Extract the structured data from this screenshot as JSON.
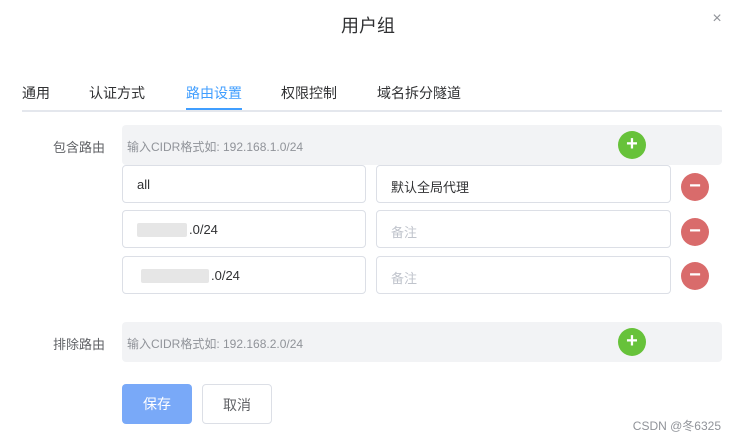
{
  "dialog": {
    "title": "用户组",
    "close_icon": "×"
  },
  "tabs": [
    {
      "label": "通用"
    },
    {
      "label": "认证方式"
    },
    {
      "label": "路由设置",
      "active": true
    },
    {
      "label": "权限控制"
    },
    {
      "label": "域名拆分隧道"
    }
  ],
  "include": {
    "label": "包含路由",
    "placeholder": "输入CIDR格式如: 192.168.1.0/24",
    "add_icon": "+",
    "rows": [
      {
        "cidr": "all",
        "remark": "默认全局代理",
        "remark_placeholder": ""
      },
      {
        "cidr": ".0/24",
        "remark": "",
        "remark_placeholder": "备注"
      },
      {
        "cidr": ".0/24",
        "remark": "",
        "remark_placeholder": "备注"
      }
    ],
    "remove_icon": "−"
  },
  "exclude": {
    "label": "排除路由",
    "placeholder": "输入CIDR格式如: 192.168.2.0/24",
    "add_icon": "+"
  },
  "actions": {
    "save": "保存",
    "cancel": "取消"
  },
  "watermark": "CSDN @冬6325",
  "colors": {
    "accent": "#409eff",
    "add": "#67c23a",
    "remove": "#d96b6b",
    "primary_button": "#79a9f8"
  }
}
